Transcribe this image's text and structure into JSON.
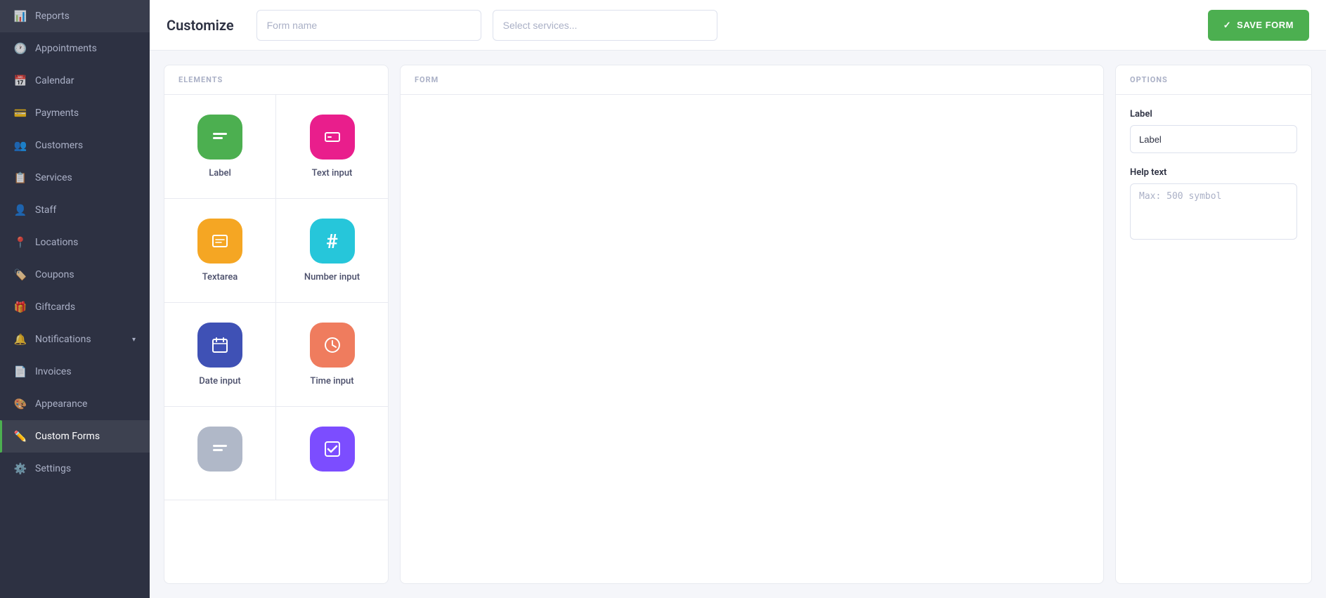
{
  "sidebar": {
    "items": [
      {
        "id": "reports",
        "label": "Reports",
        "icon": "📊"
      },
      {
        "id": "appointments",
        "label": "Appointments",
        "icon": "🕐"
      },
      {
        "id": "calendar",
        "label": "Calendar",
        "icon": "📅"
      },
      {
        "id": "payments",
        "label": "Payments",
        "icon": "💳"
      },
      {
        "id": "customers",
        "label": "Customers",
        "icon": "👥"
      },
      {
        "id": "services",
        "label": "Services",
        "icon": "📋"
      },
      {
        "id": "staff",
        "label": "Staff",
        "icon": "👤"
      },
      {
        "id": "locations",
        "label": "Locations",
        "icon": "📍"
      },
      {
        "id": "coupons",
        "label": "Coupons",
        "icon": "🏷️"
      },
      {
        "id": "giftcards",
        "label": "Giftcards",
        "icon": "🎁"
      },
      {
        "id": "notifications",
        "label": "Notifications",
        "icon": "🔔",
        "hasChevron": true
      },
      {
        "id": "invoices",
        "label": "Invoices",
        "icon": "📄"
      },
      {
        "id": "appearance",
        "label": "Appearance",
        "icon": "🎨"
      },
      {
        "id": "custom-forms",
        "label": "Custom Forms",
        "icon": "✏️",
        "active": true
      },
      {
        "id": "settings",
        "label": "Settings",
        "icon": "⚙️"
      }
    ]
  },
  "topbar": {
    "title": "Customize",
    "form_name_placeholder": "Form name",
    "select_services_placeholder": "Select services...",
    "save_button_label": "SAVE FORM",
    "save_icon": "✓"
  },
  "elements_panel": {
    "header": "ELEMENTS",
    "items": [
      {
        "id": "label",
        "label": "Label",
        "icon_class": "icon-green",
        "icon": "▣"
      },
      {
        "id": "text-input",
        "label": "Text input",
        "icon_class": "icon-pink",
        "icon": "⊟"
      },
      {
        "id": "textarea",
        "label": "Textarea",
        "icon_class": "icon-orange",
        "icon": "⊟"
      },
      {
        "id": "number-input",
        "label": "Number input",
        "icon_class": "icon-teal",
        "icon": "#"
      },
      {
        "id": "date-input",
        "label": "Date input",
        "icon_class": "icon-blue",
        "icon": "📅"
      },
      {
        "id": "time-input",
        "label": "Time input",
        "icon_class": "icon-salmon",
        "icon": "🕐"
      },
      {
        "id": "item7",
        "label": "",
        "icon_class": "icon-gray",
        "icon": "▣"
      },
      {
        "id": "item8",
        "label": "",
        "icon_class": "icon-purple",
        "icon": "☑"
      }
    ]
  },
  "form_panel": {
    "header": "FORM"
  },
  "options_panel": {
    "header": "OPTIONS",
    "label_field": {
      "label": "Label",
      "value": "Label",
      "placeholder": "Label"
    },
    "help_text_field": {
      "label": "Help text",
      "placeholder": "Max: 500 symbol"
    }
  }
}
